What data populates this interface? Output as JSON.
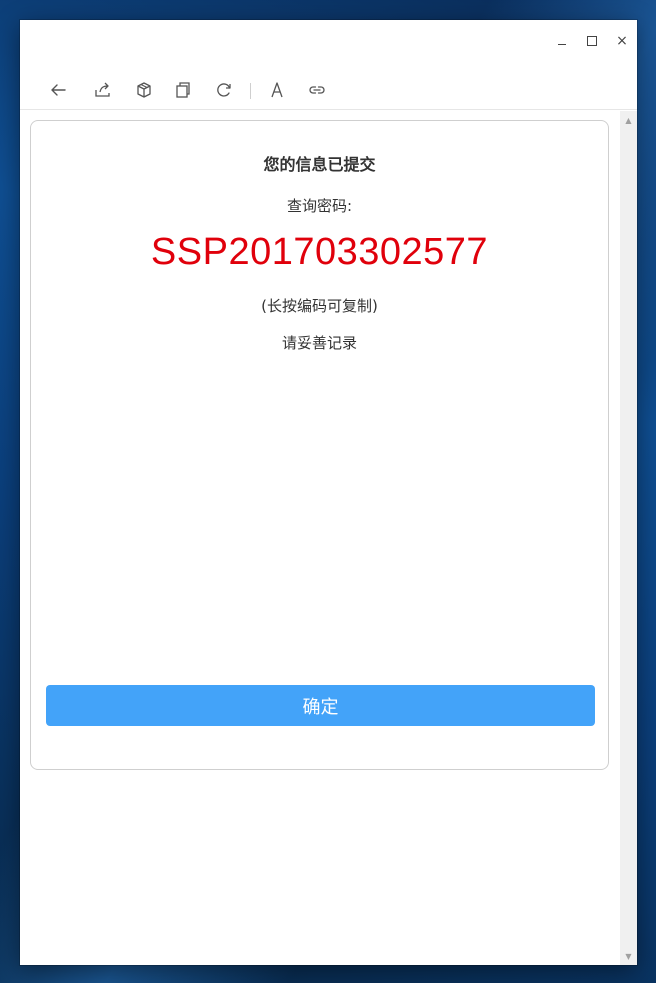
{
  "window": {
    "controls": {
      "minimize_icon": "minimize-icon",
      "maximize_icon": "maximize-icon",
      "close_icon": "close-icon",
      "close_glyph": "×"
    }
  },
  "toolbar": {
    "icons": [
      "back-arrow-icon",
      "share-icon",
      "cube-icon",
      "copy-icon",
      "refresh-icon",
      "font-icon",
      "link-icon"
    ],
    "font_glyph": "A"
  },
  "card": {
    "title": "您的信息已提交",
    "password_label": "查询密码:",
    "password_code": "SSP201703302577",
    "copy_hint": "(长按编码可复制)",
    "keep_note": "请妥善记录",
    "confirm_label": "确定"
  },
  "colors": {
    "code": "#e0000b",
    "button": "#43a3f9"
  }
}
